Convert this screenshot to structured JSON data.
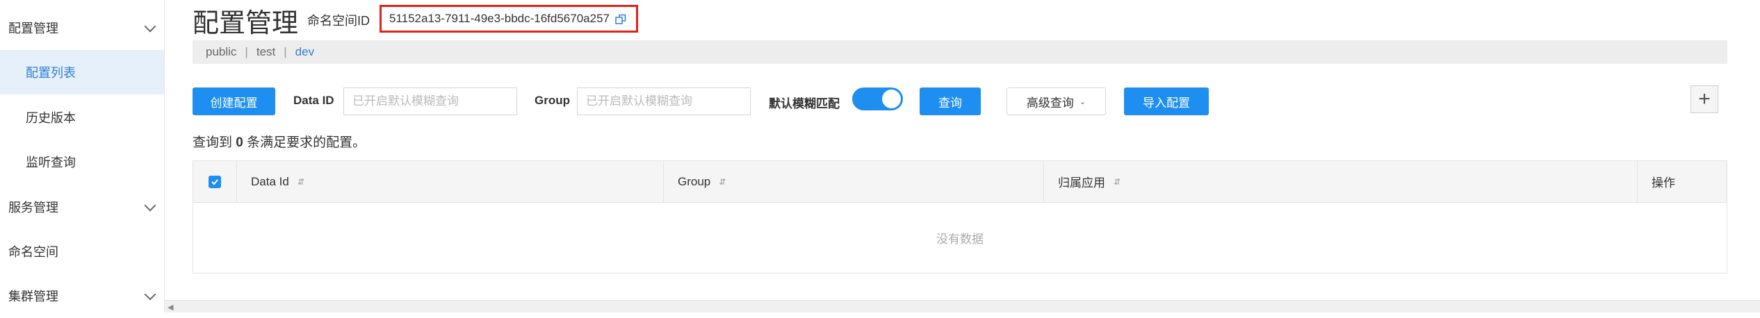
{
  "sidebar": {
    "items": [
      {
        "label": "配置管理",
        "type": "group"
      },
      {
        "label": "配置列表",
        "type": "sub"
      },
      {
        "label": "历史版本",
        "type": "sub"
      },
      {
        "label": "监听查询",
        "type": "sub"
      },
      {
        "label": "服务管理",
        "type": "group"
      },
      {
        "label": "命名空间",
        "type": "item"
      },
      {
        "label": "集群管理",
        "type": "group"
      }
    ]
  },
  "header": {
    "title": "配置管理",
    "namespace_label": "命名空间ID",
    "namespace_id": "51152a13-7911-49e3-bbdc-16fd5670a257"
  },
  "namespaces": {
    "public": "public",
    "test": "test",
    "dev": "dev",
    "sep": "|"
  },
  "toolbar": {
    "create_label": "创建配置",
    "dataid_label": "Data ID",
    "dataid_placeholder": "已开启默认模糊查询",
    "group_label": "Group",
    "group_placeholder": "已开启默认模糊查询",
    "fuzzy_label": "默认模糊匹配",
    "fuzzy_on": true,
    "search_label": "查询",
    "advanced_label": "高级查询",
    "import_label": "导入配置",
    "plus_label": "+"
  },
  "result": {
    "prefix": "查询到",
    "count": "0",
    "suffix": "条满足要求的配置。"
  },
  "table": {
    "columns": [
      "Data Id",
      "Group",
      "归属应用",
      "操作"
    ],
    "empty_text": "没有数据"
  },
  "colors": {
    "primary": "#1e8ef0",
    "highlight_border": "#e0221b"
  }
}
